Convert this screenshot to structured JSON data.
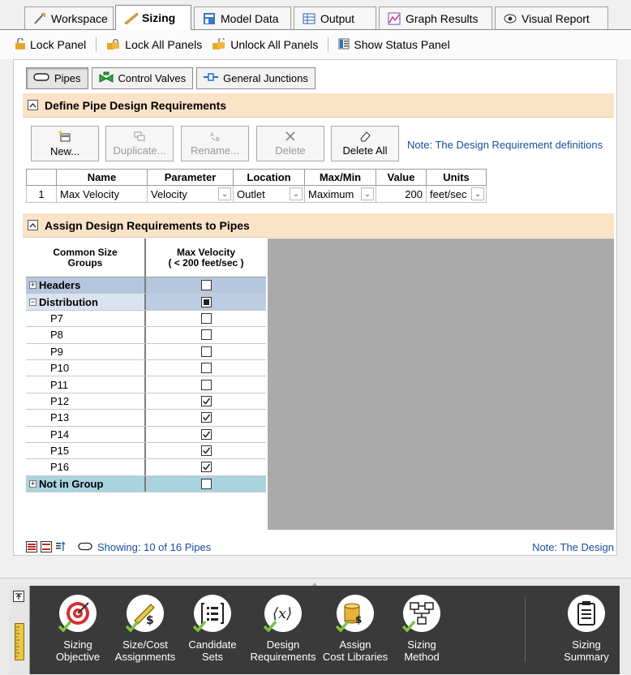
{
  "tabs": [
    {
      "label": "Workspace",
      "icon": "workspace-icon"
    },
    {
      "label": "Sizing",
      "icon": "sizing-icon",
      "active": true
    },
    {
      "label": "Model Data",
      "icon": "model-data-icon"
    },
    {
      "label": "Output",
      "icon": "output-icon"
    },
    {
      "label": "Graph Results",
      "icon": "graph-results-icon"
    },
    {
      "label": "Visual Report",
      "icon": "visual-report-icon"
    }
  ],
  "toolbar": {
    "lock_panel": "Lock Panel",
    "lock_all": "Lock All Panels",
    "unlock_all": "Unlock All Panels",
    "show_status": "Show Status Panel"
  },
  "subtabs": [
    {
      "label": "Pipes",
      "active": true
    },
    {
      "label": "Control Valves"
    },
    {
      "label": "General Junctions"
    }
  ],
  "define_section": {
    "title": "Define Pipe Design Requirements",
    "buttons": {
      "new": "New...",
      "duplicate": "Duplicate...",
      "rename": "Rename...",
      "delete": "Delete",
      "delete_all": "Delete All"
    },
    "note": "Note: The Design Requirement definitions"
  },
  "requirements_table": {
    "headers": [
      "Name",
      "Parameter",
      "Location",
      "Max/Min",
      "Value",
      "Units"
    ],
    "rows": [
      {
        "index": "1",
        "name": "Max Velocity",
        "parameter": "Velocity",
        "location": "Outlet",
        "maxmin": "Maximum",
        "value": "200",
        "units": "feet/sec"
      }
    ]
  },
  "assign_section": {
    "title": "Assign Design Requirements to Pipes",
    "col1_header_line1": "Common Size",
    "col1_header_line2": "Groups",
    "col2_header_line1": "Max Velocity",
    "col2_header_line2": "( < 200 feet/sec )",
    "rows": [
      {
        "label": "Headers",
        "type": "group-collapsed",
        "state": "unchecked"
      },
      {
        "label": "Distribution",
        "type": "group-expanded",
        "state": "partial"
      },
      {
        "label": "P7",
        "type": "item",
        "state": "unchecked"
      },
      {
        "label": "P8",
        "type": "item",
        "state": "unchecked"
      },
      {
        "label": "P9",
        "type": "item",
        "state": "unchecked"
      },
      {
        "label": "P10",
        "type": "item",
        "state": "unchecked"
      },
      {
        "label": "P11",
        "type": "item",
        "state": "unchecked"
      },
      {
        "label": "P12",
        "type": "item",
        "state": "checked"
      },
      {
        "label": "P13",
        "type": "item",
        "state": "checked"
      },
      {
        "label": "P14",
        "type": "item",
        "state": "checked"
      },
      {
        "label": "P15",
        "type": "item",
        "state": "checked"
      },
      {
        "label": "P16",
        "type": "item",
        "state": "checked"
      },
      {
        "label": "Not in Group",
        "type": "group-notgroup",
        "state": "unchecked"
      }
    ]
  },
  "status": {
    "showing": "Showing: 10 of 16 Pipes",
    "note": "Note: The Design"
  },
  "nav": [
    {
      "line1": "Sizing",
      "line2": "Objective",
      "icon": "target-icon"
    },
    {
      "line1": "Size/Cost",
      "line2": "Assignments",
      "icon": "ruler-dollar-icon"
    },
    {
      "line1": "Candidate",
      "line2": "Sets",
      "icon": "list-icon"
    },
    {
      "line1": "Design",
      "line2": "Requirements",
      "icon": "variable-x-icon"
    },
    {
      "line1": "Assign",
      "line2": "Cost Libraries",
      "icon": "coins-icon"
    },
    {
      "line1": "Sizing",
      "line2": "Method",
      "icon": "flowchart-icon"
    },
    {
      "line1": "Sizing",
      "line2": "Summary",
      "icon": "clipboard-icon"
    }
  ],
  "colors": {
    "section_header": "#fbe3c8",
    "note_text": "#1a4fa0",
    "nav_background": "#3a3a3a",
    "check_green": "#7cc242",
    "grid_grey": "#aaaaaa"
  }
}
